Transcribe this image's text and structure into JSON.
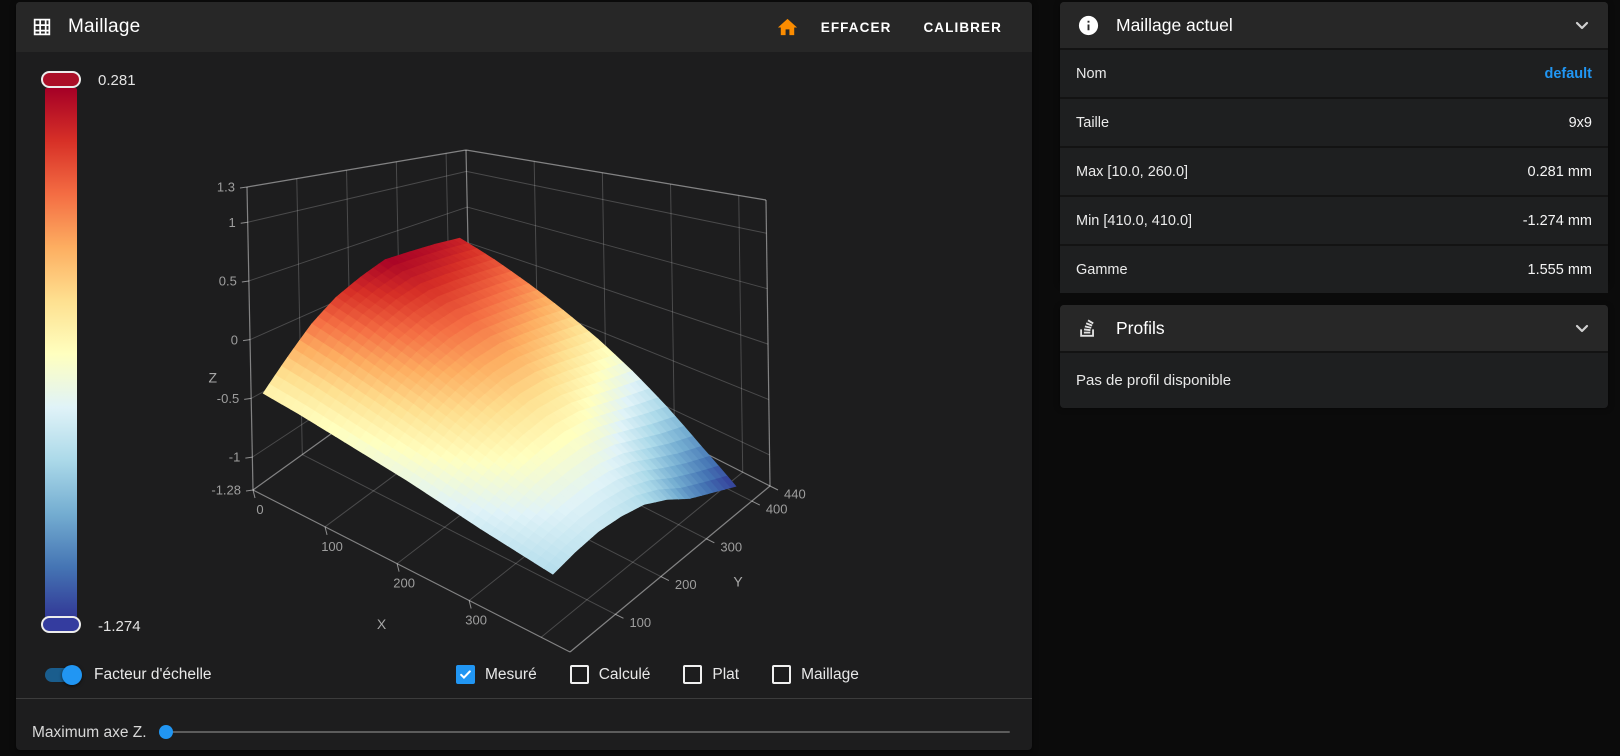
{
  "theme": {
    "accent": "#2196f3",
    "link_color": "#2196f3",
    "home_icon_color": "#fb8c00",
    "card_bg": "#1d1d1e",
    "toolbar_bg": "#272727",
    "page_bg": "#0b0b0b"
  },
  "toolbar": {
    "title": "Maillage",
    "clear_label": "EFFACER",
    "calibrate_label": "CALIBRER"
  },
  "colorbar": {
    "max_label": "0.281",
    "min_label": "-1.274",
    "top_handle_color": "#ab0f28",
    "bottom_handle_color": "#343c9f",
    "gradient_stops": [
      "#a50026",
      "#d73027",
      "#f46d43",
      "#fdae61",
      "#fee090",
      "#ffffbf",
      "#e0f3f8",
      "#abd9e9",
      "#74add1",
      "#4575b4",
      "#313695"
    ]
  },
  "controls": {
    "scale_toggle": {
      "label": "Facteur d'échelle",
      "on": true
    },
    "view_checkboxes": [
      {
        "label": "Mesuré",
        "checked": true
      },
      {
        "label": "Calculé",
        "checked": false
      },
      {
        "label": "Plat",
        "checked": false
      },
      {
        "label": "Maillage",
        "checked": false
      }
    ],
    "z_max_slider": {
      "label": "Maximum axe Z.",
      "value_fraction": 0
    }
  },
  "mesh_panel": {
    "title": "Maillage actuel",
    "rows": [
      {
        "label": "Nom",
        "value": "default"
      },
      {
        "label": "Taille",
        "value": "9x9"
      },
      {
        "label": "Max [10.0, 260.0]",
        "value": "0.281 mm"
      },
      {
        "label": "Min [410.0, 410.0]",
        "value": "-1.274 mm"
      },
      {
        "label": "Gamme",
        "value": "1.555 mm"
      }
    ]
  },
  "profiles_panel": {
    "title": "Profils",
    "empty_text": "Pas de profil disponible"
  },
  "chart_data": {
    "type": "surface",
    "title": "Bed mesh heightmap (mesuré)",
    "xlabel": "X",
    "ylabel": "Y",
    "zlabel": "Z",
    "x": [
      10,
      60,
      110,
      160,
      210,
      260,
      310,
      360,
      410
    ],
    "y": [
      10,
      60,
      110,
      160,
      210,
      260,
      310,
      360,
      410
    ],
    "z": [
      [
        -0.45,
        -0.48,
        -0.52,
        -0.56,
        -0.6,
        -0.65,
        -0.7,
        -0.74,
        -0.78
      ],
      [
        -0.25,
        -0.3,
        -0.36,
        -0.42,
        -0.48,
        -0.55,
        -0.62,
        -0.68,
        -0.74
      ],
      [
        -0.05,
        -0.12,
        -0.2,
        -0.28,
        -0.37,
        -0.46,
        -0.55,
        -0.64,
        -0.72
      ],
      [
        0.1,
        0.02,
        -0.08,
        -0.18,
        -0.29,
        -0.4,
        -0.52,
        -0.63,
        -0.74
      ],
      [
        0.2,
        0.11,
        0.0,
        -0.12,
        -0.24,
        -0.37,
        -0.51,
        -0.65,
        -0.79
      ],
      [
        0.281,
        0.16,
        0.03,
        -0.1,
        -0.24,
        -0.39,
        -0.55,
        -0.72,
        -0.9
      ],
      [
        0.26,
        0.14,
        0.0,
        -0.14,
        -0.29,
        -0.46,
        -0.64,
        -0.84,
        -1.05
      ],
      [
        0.23,
        0.1,
        -0.04,
        -0.19,
        -0.36,
        -0.54,
        -0.74,
        -0.96,
        -1.16
      ],
      [
        0.18,
        0.05,
        -0.1,
        -0.26,
        -0.43,
        -0.62,
        -0.83,
        -1.06,
        -1.274
      ]
    ],
    "x_tick_labels": [
      "0",
      "100",
      "200",
      "300"
    ],
    "y_tick_labels": [
      "100",
      "200",
      "300",
      "400",
      "440"
    ],
    "z_tick_labels": [
      "1.3",
      "1",
      "0.5",
      "0",
      "-0.5",
      "-1",
      "-1.28"
    ],
    "x_range": [
      0,
      440
    ],
    "y_range": [
      0,
      440
    ],
    "z_range": [
      -1.28,
      1.3
    ],
    "color_range": [
      -1.274,
      0.281
    ],
    "colorscale": [
      "#313695",
      "#4575b4",
      "#74add1",
      "#abd9e9",
      "#e0f3f8",
      "#ffffbf",
      "#fee090",
      "#fdae61",
      "#f46d43",
      "#d73027",
      "#a50026"
    ],
    "grid": true,
    "legend": "colorbar-left"
  }
}
